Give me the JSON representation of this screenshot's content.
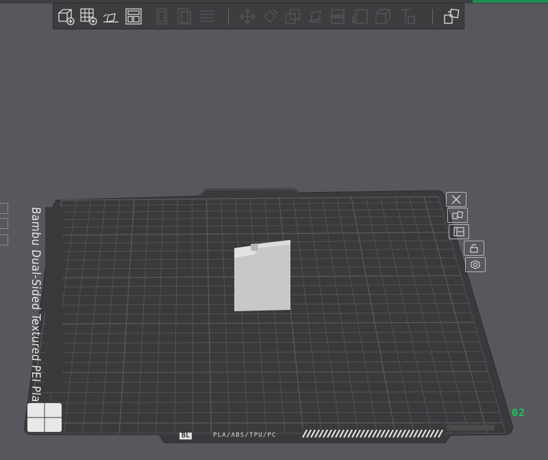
{
  "toolbar": {
    "buttons": [
      {
        "name": "add-object",
        "icon": "cube-plus-icon",
        "enabled": true
      },
      {
        "name": "add-plate",
        "icon": "grid-plus-icon",
        "enabled": true
      },
      {
        "name": "auto-orient",
        "icon": "auto-orient-icon",
        "enabled": true
      },
      {
        "name": "arrange",
        "icon": "arrange-icon",
        "enabled": true
      },
      {
        "name": "copy",
        "icon": "copy-icon",
        "enabled": false
      },
      {
        "name": "paste",
        "icon": "paste-icon",
        "enabled": false
      },
      {
        "name": "layers",
        "icon": "layers-icon",
        "enabled": false
      },
      {
        "name": "move",
        "icon": "move-icon",
        "enabled": false
      },
      {
        "name": "rotate",
        "icon": "rotate-icon",
        "enabled": false
      },
      {
        "name": "scale",
        "icon": "scale-icon",
        "enabled": false
      },
      {
        "name": "lay-on-face",
        "icon": "lay-on-face-icon",
        "enabled": false
      },
      {
        "name": "cut",
        "icon": "cut-icon",
        "enabled": false
      },
      {
        "name": "support-paint",
        "icon": "support-paint-icon",
        "enabled": false
      },
      {
        "name": "seam",
        "icon": "seam-icon",
        "enabled": false
      },
      {
        "name": "text",
        "icon": "text-icon",
        "enabled": false
      },
      {
        "name": "assembly",
        "icon": "assembly-icon",
        "enabled": true
      }
    ]
  },
  "plate": {
    "label": "Bambu Dual-Sided Textured PEI Plate",
    "number": "02",
    "filament_text": "PLA/ABS/TPU/PC",
    "logo_text": "BL"
  },
  "plate_tools": [
    {
      "name": "delete-plate",
      "icon": "close-icon"
    },
    {
      "name": "orient-plate",
      "icon": "orient-icon"
    },
    {
      "name": "arrange-plate",
      "icon": "arrange-icon"
    },
    {
      "name": "lock-plate",
      "icon": "lock-icon"
    },
    {
      "name": "plate-settings",
      "icon": "gear-icon"
    }
  ],
  "colors": {
    "background": "#58575d",
    "plate": "#3a3a3c",
    "grid": "#5c5c60",
    "object": "#c4c4c4",
    "accent": "#17c85a"
  }
}
